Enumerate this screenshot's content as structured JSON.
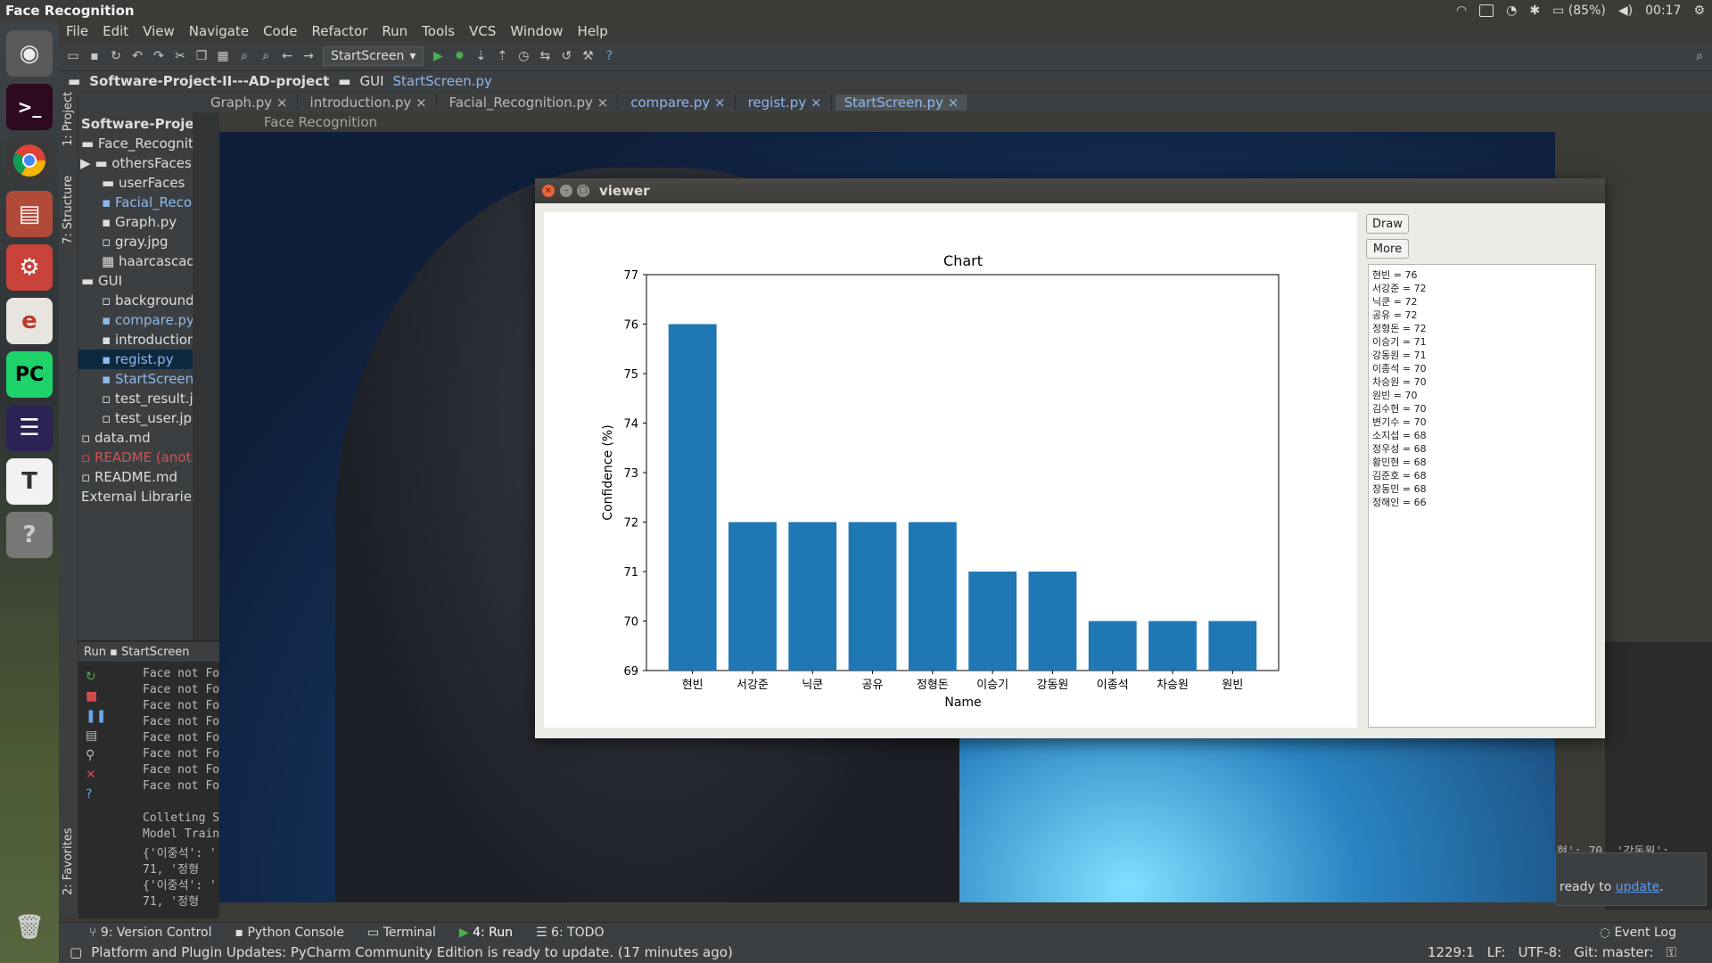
{
  "top_panel": {
    "title": "Face Recognition",
    "battery": "(85%)",
    "time": "00:17"
  },
  "menu": [
    "File",
    "Edit",
    "View",
    "Navigate",
    "Code",
    "Refactor",
    "Run",
    "Tools",
    "VCS",
    "Window",
    "Help"
  ],
  "toolbar": {
    "run_config": "StartScreen"
  },
  "breadcrumb": [
    "Software-Project-II---AD-project",
    "GUI",
    "StartScreen.py"
  ],
  "editor_tabs": [
    {
      "label": "Graph.py"
    },
    {
      "label": "introduction.py"
    },
    {
      "label": "Facial_Recognition.py"
    },
    {
      "label": "compare.py"
    },
    {
      "label": "regist.py"
    },
    {
      "label": "StartScreen.py"
    }
  ],
  "project_tree": {
    "side_label": "1: Project",
    "structure_label": "7: Structure",
    "favorites_label": "2: Favorites",
    "items": [
      {
        "label": "Software-Project"
      },
      {
        "label": "Face_Recogniti"
      },
      {
        "label": "othersFaces"
      },
      {
        "label": "userFaces"
      },
      {
        "label": "Facial_Recog"
      },
      {
        "label": "Graph.py"
      },
      {
        "label": "gray.jpg"
      },
      {
        "label": "haarcascade"
      },
      {
        "label": "GUI"
      },
      {
        "label": "background."
      },
      {
        "label": "compare.py"
      },
      {
        "label": "introduction"
      },
      {
        "label": "regist.py"
      },
      {
        "label": "StartScreen."
      },
      {
        "label": "test_result.jp"
      },
      {
        "label": "test_user.jpg"
      },
      {
        "label": "data.md"
      },
      {
        "label": "README (anotl"
      },
      {
        "label": "README.md"
      },
      {
        "label": "External Libraries"
      }
    ]
  },
  "face_window": {
    "title": "Face Recognition"
  },
  "run_panel": {
    "header": "Run",
    "config": "StartScreen",
    "lines": [
      "Face not Fo",
      "Face not Fo",
      "Face not Fo",
      "Face not Fo",
      "Face not Fo",
      "Face not Fo",
      "Face not Fo",
      "Face not Fo",
      "Colleting S",
      "Model Train",
      "{'이중석': '",
      "  71, '정형",
      "{'이중석': '",
      "  71, '정형"
    ],
    "right_text": "현': 70, '강동원':",
    "update_text": "ready to",
    "update_link": "update"
  },
  "viewer": {
    "title": "viewer",
    "draw_label": "Draw",
    "more_label": "More",
    "results": [
      "현빈 = 76",
      "서강준 = 72",
      "닉쿤 = 72",
      "공유 = 72",
      "정형돈 = 72",
      "이승기 = 71",
      "강동원 = 71",
      "이종석 = 70",
      "차승원 = 70",
      "원빈 = 70",
      "김수현 = 70",
      "변기수 = 70",
      "소지섭 = 68",
      "정우성 = 68",
      "황민현 = 68",
      "김준호 = 68",
      "장동민 = 68",
      "정해인 = 66"
    ]
  },
  "chart_data": {
    "type": "bar",
    "title": "Chart",
    "xlabel": "Name",
    "ylabel": "Confidence (%)",
    "categories": [
      "현빈",
      "서강준",
      "닉쿤",
      "공유",
      "정형돈",
      "이승기",
      "강동원",
      "이종석",
      "차승원",
      "원빈"
    ],
    "values": [
      76,
      72,
      72,
      72,
      72,
      71,
      71,
      70,
      70,
      70
    ],
    "ylim": [
      69,
      77
    ],
    "yticks": [
      69,
      70,
      71,
      72,
      73,
      74,
      75,
      76,
      77
    ],
    "bar_color": "#1f77b4",
    "grid": false
  },
  "toolwindows": [
    "9: Version Control",
    "Python Console",
    "Terminal",
    "4: Run",
    "6: TODO"
  ],
  "event_log": "Event Log",
  "status": {
    "message": "Platform and Plugin Updates: PyCharm Community Edition is ready to update. (17 minutes ago)",
    "position": "1229:1",
    "line_sep": "LF:",
    "encoding": "UTF-8:",
    "git": "Git: master:"
  }
}
